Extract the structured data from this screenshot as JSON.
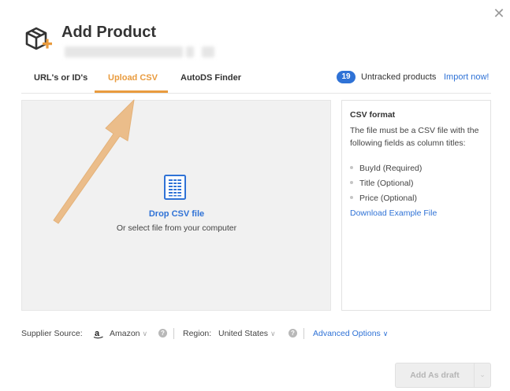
{
  "dialog": {
    "title": "Add Product",
    "close_icon": "close-icon",
    "header_icon": "box-plus-icon"
  },
  "tabs": [
    {
      "label": "URL's or ID's"
    },
    {
      "label": "Upload CSV"
    },
    {
      "label": "AutoDS Finder"
    }
  ],
  "active_tab": "Upload CSV",
  "untracked": {
    "count": "19",
    "label": "Untracked products",
    "link": "Import now!"
  },
  "dropzone": {
    "icon": "csv-file-icon",
    "title": "Drop CSV file",
    "subtitle": "Or select file from your computer"
  },
  "csv_format": {
    "title": "CSV format",
    "description": "The file must be a CSV file with the following fields as column titles:",
    "fields": [
      "BuyId (Required)",
      "Title (Optional)",
      "Price (Optional)"
    ],
    "download_link": "Download Example File"
  },
  "footer": {
    "supplier_label": "Supplier Source:",
    "supplier_value": "Amazon",
    "supplier_icon": "amazon-logo-icon",
    "region_label": "Region:",
    "region_value": "United States",
    "advanced_options": "Advanced Options",
    "add_draft_button": "Add As draft"
  },
  "colors": {
    "accent": "#e99b3e",
    "link": "#2f72d6",
    "badge": "#2f72d6"
  }
}
